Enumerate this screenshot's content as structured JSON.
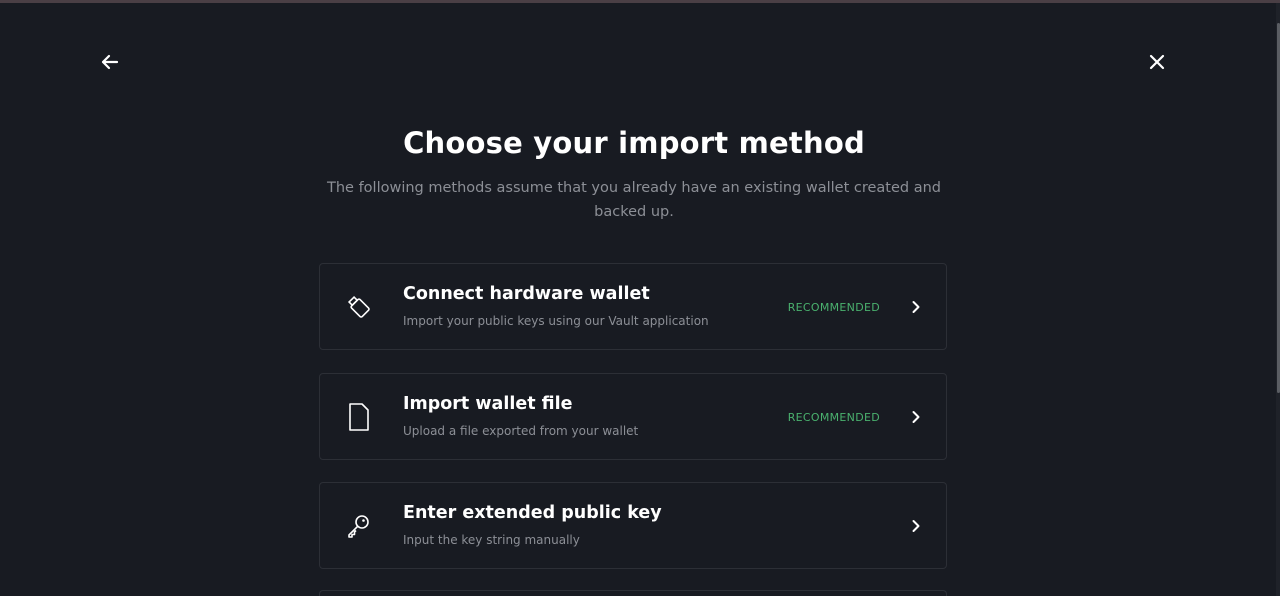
{
  "header": {
    "back_icon": "arrow-left-icon",
    "close_icon": "close-icon"
  },
  "page": {
    "title": "Choose your import method",
    "subtitle": "The following methods assume that you already have an existing wallet created and backed up."
  },
  "methods": [
    {
      "icon": "usb-device-icon",
      "title": "Connect hardware wallet",
      "description": "Import your public keys using our Vault application",
      "badge": "RECOMMENDED"
    },
    {
      "icon": "file-icon",
      "title": "Import wallet file",
      "description": "Upload a file exported from your wallet",
      "badge": "RECOMMENDED"
    },
    {
      "icon": "key-icon",
      "title": "Enter extended public key",
      "description": "Input the key string manually",
      "badge": ""
    }
  ],
  "colors": {
    "background": "#181b22",
    "card_border": "#2c2f36",
    "muted_text": "#8c8f96",
    "recommended": "#4ab16e"
  }
}
